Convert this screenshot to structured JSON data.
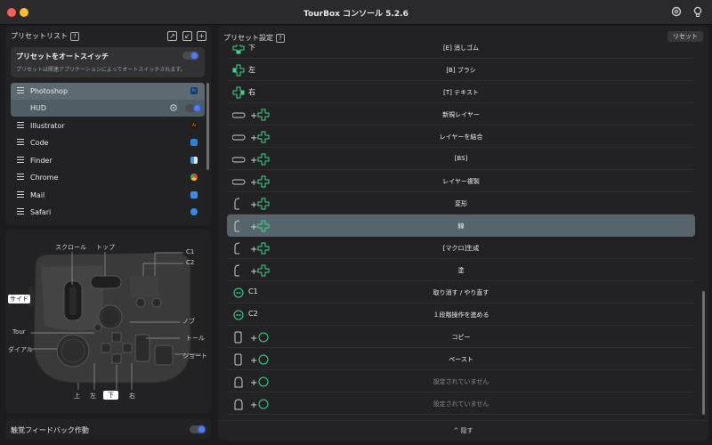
{
  "window": {
    "title": "TourBox コンソール 5.2.6",
    "settings_icon": "gear-icon",
    "tips_icon": "lightbulb-icon"
  },
  "left": {
    "presets_title": "プリセットリスト",
    "help_mark": "?",
    "icons": [
      "export-icon",
      "import-icon",
      "add-icon"
    ],
    "autoswitch": {
      "title": "プリセットをオートスイッチ",
      "desc": "プリセットは関連アプリケーションによってオートスイッチされます。"
    },
    "presets": [
      {
        "name": "Photoshop",
        "badge": "Ps",
        "color": "#1d3c6e"
      },
      {
        "name": "HUD",
        "badge": "",
        "color": ""
      },
      {
        "name": "Illustrator",
        "badge": "Ai",
        "color": "#3a1a00"
      },
      {
        "name": "Code",
        "badge": "",
        "color": "#2d7fd0"
      },
      {
        "name": "Finder",
        "badge": "",
        "color": "#3f9be6"
      },
      {
        "name": "Chrome",
        "badge": "",
        "color": "#e0b43a"
      },
      {
        "name": "Mail",
        "badge": "",
        "color": "#3e8ee8"
      },
      {
        "name": "Safari",
        "badge": "",
        "color": "#2f8fe8"
      }
    ],
    "device_labels": {
      "scroll": "スクロール",
      "top": "トップ",
      "c1": "C1",
      "c2": "C2",
      "side": "サイド",
      "knob": "ノブ",
      "tour": "Tour",
      "tall": "トール",
      "dial": "ダイアル",
      "short": "ショート",
      "up": "上",
      "left": "左",
      "down": "下",
      "right": "右"
    },
    "haptic": "触覚フィードバック作動"
  },
  "right": {
    "title": "プリセット設定",
    "help_mark": "?",
    "reset": "リセット",
    "plus": "+",
    "rows": [
      {
        "combo": "dpad",
        "key": "下",
        "action": "[E] 消しゴム"
      },
      {
        "combo": "dpad",
        "key": "左",
        "action": "[B] ブラシ"
      },
      {
        "combo": "dpad",
        "key": "右",
        "action": "[T] テキスト"
      },
      {
        "combo": "side+dpad",
        "key": "",
        "action": "新規レイヤー"
      },
      {
        "combo": "side+dpad",
        "key": "",
        "action": "レイヤーを結合"
      },
      {
        "combo": "side+dpad",
        "key": "",
        "action": "[BS]"
      },
      {
        "combo": "side+dpad",
        "key": "",
        "action": "レイヤー複製"
      },
      {
        "combo": "top+dpad",
        "key": "",
        "action": "変形"
      },
      {
        "combo": "top+dpad",
        "key": "",
        "action": "線"
      },
      {
        "combo": "top+dpad",
        "key": "",
        "action": "[マクロ]生成"
      },
      {
        "combo": "top+dpad",
        "key": "",
        "action": "塗"
      },
      {
        "combo": "c",
        "key": "C1",
        "action": "取り消す / やり直す"
      },
      {
        "combo": "c",
        "key": "C2",
        "action": "１段階操作を進める"
      },
      {
        "combo": "tall+c",
        "key": "",
        "action": "コピー"
      },
      {
        "combo": "tall+c",
        "key": "",
        "action": "ペースト"
      },
      {
        "combo": "short+c",
        "key": "",
        "action": "設定されていません"
      },
      {
        "combo": "short+c",
        "key": "",
        "action": "設定されていません"
      }
    ],
    "hide": "^ 隠す"
  }
}
